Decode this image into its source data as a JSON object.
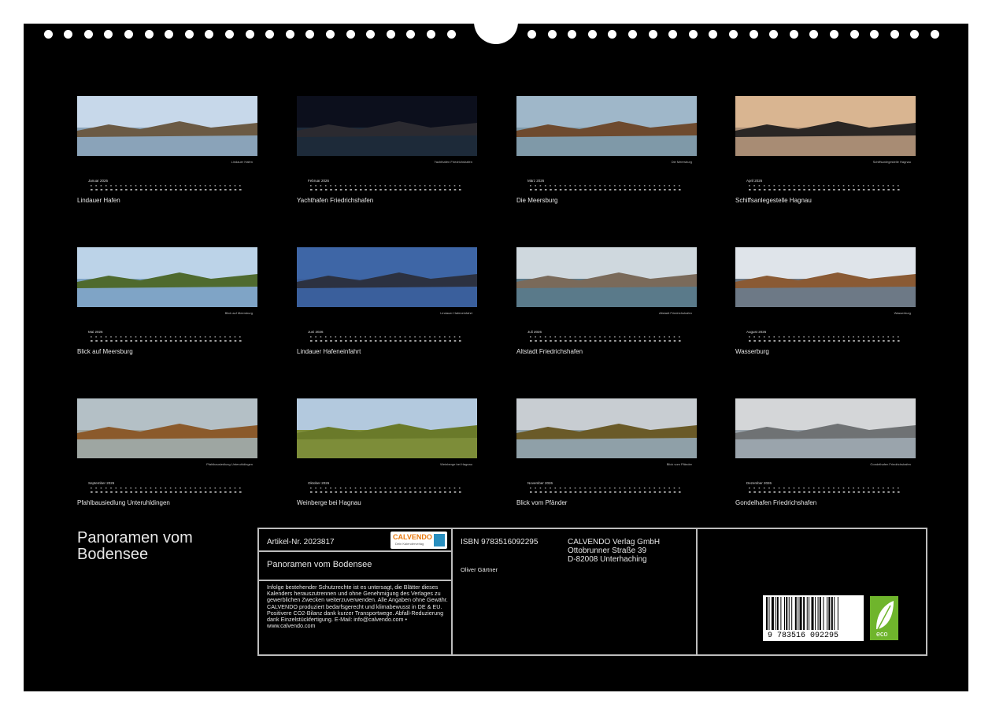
{
  "months": [
    {
      "month_label": "Januar 2026",
      "photo_caption": "Lindauer Hafen",
      "title": "Lindauer Hafen",
      "sky": "#c7d8ea",
      "ground": "#6b5a44",
      "water": "#8aa3b8"
    },
    {
      "month_label": "Februar 2026",
      "photo_caption": "Yachthafen Friedrichshafen",
      "title": "Yachthafen Friedrichshafen",
      "sky": "#0c0f1c",
      "ground": "#2b2a30",
      "water": "#1d2a3a"
    },
    {
      "month_label": "März 2026",
      "photo_caption": "Die Meersburg",
      "title": "Die Meersburg",
      "sky": "#9fb7c9",
      "ground": "#6e4a2e",
      "water": "#7f99a8"
    },
    {
      "month_label": "April 2026",
      "photo_caption": "Schiffsanlegestelle Hagnau",
      "title": "Schiffsanlegestelle Hagnau",
      "sky": "#d9b591",
      "ground": "#2a2624",
      "water": "#a88c74"
    },
    {
      "month_label": "Mai 2026",
      "photo_caption": "Blick auf Meersburg",
      "title": "Blick auf Meersburg",
      "sky": "#bcd3e8",
      "ground": "#4f6a2e",
      "water": "#7fa4c6"
    },
    {
      "month_label": "Juni 2026",
      "photo_caption": "Lindauer Hafeneinfahrt",
      "title": "Lindauer Hafeneinfahrt",
      "sky": "#3e66a6",
      "ground": "#2c3140",
      "water": "#3b5f9c"
    },
    {
      "month_label": "Juli 2026",
      "photo_caption": "Altstadt Friedrichshafen",
      "title": "Altstadt Friedrichshafen",
      "sky": "#cfd8de",
      "ground": "#7a6a5a",
      "water": "#5b7a8a"
    },
    {
      "month_label": "August 2026",
      "photo_caption": "Wasserburg",
      "title": "Wasserburg",
      "sky": "#dfe4ea",
      "ground": "#8a5a34",
      "water": "#6d7986"
    },
    {
      "month_label": "September 2026",
      "photo_caption": "Pfahlbausiedlung Unteruhldingen",
      "title": "Pfahlbausiedlung Unteruhldingen",
      "sky": "#b4c0c6",
      "ground": "#8b5a2b",
      "water": "#9ea6a2"
    },
    {
      "month_label": "Oktober 2026",
      "photo_caption": "Weinberge bei Hagnau",
      "title": "Weinberge bei Hagnau",
      "sky": "#b3c9de",
      "ground": "#6a7a2a",
      "water": "#7d8d3a"
    },
    {
      "month_label": "November 2026",
      "photo_caption": "Blick vom Pfänder",
      "title": "Blick vom Pfänder",
      "sky": "#c8cdd2",
      "ground": "#6a5a28",
      "water": "#8fa0a8"
    },
    {
      "month_label": "Dezember 2026",
      "photo_caption": "Gondelhafen Friedrichshafen",
      "title": "Gondelhafen Friedrichshafen",
      "sky": "#d4d6d8",
      "ground": "#6f7274",
      "water": "#9aa4ac"
    }
  ],
  "main_title": "Panoramen vom Bodensee",
  "info": {
    "article_no": "Artikel-Nr. 2023817",
    "logo_name": "CALVENDO",
    "logo_sub": "Dein Kalenderverlag",
    "product_title": "Panoramen vom Bodensee",
    "legal_text": "Infolge bestehender Schutzrechte ist es untersagt, die Blätter dieses Kalenders herauszutrennen und ohne Genehmigung des Verlages zu gewerblichen Zwecken weiterzuverwenden. Alle Angaben ohne Gewähr. CALVENDO produziert bedarfsgerecht und klimabewusst in DE & EU. Positivere CO2-Bilanz dank kurzer Transportwege. Abfall-Reduzierung dank Einzelstückfertigung. E-Mail: info@calvendo.com • www.calvendo.com",
    "isbn": "ISBN 9783516092295",
    "author": "Oliver Gärtner",
    "publisher_name": "CALVENDO Verlag GmbH",
    "publisher_street": "Ottobrunner Straße 39",
    "publisher_city": "D-82008 Unterhaching",
    "barcode_digits": "9 783516 092295",
    "eco_label": "eco"
  }
}
